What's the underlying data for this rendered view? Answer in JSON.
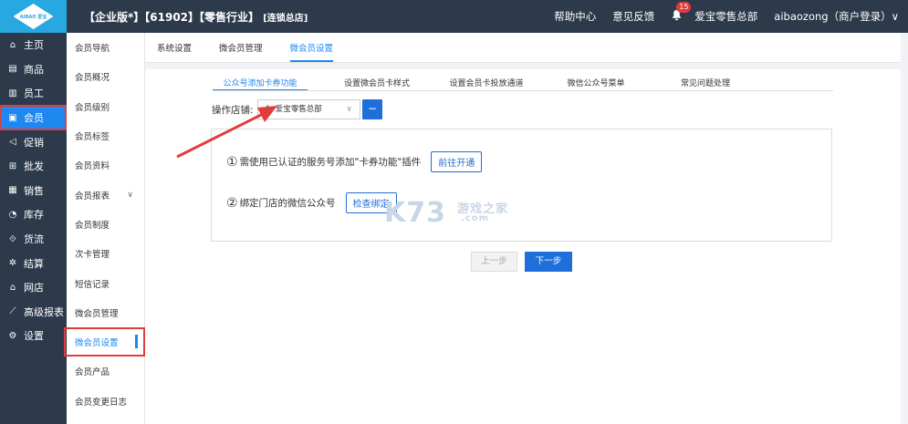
{
  "topbar": {
    "logo_text": "AIBAO 爱宝",
    "title_main": "【企业版*】【61902】【零售行业】",
    "title_small": "[连锁总店]",
    "help": "帮助中心",
    "feedback": "意见反馈",
    "notif_count": "15",
    "company": "爱宝零售总部",
    "user": "aibaozong（商户登录）∨"
  },
  "mainnav": {
    "items": [
      {
        "label": "主页",
        "icon": "home-icon",
        "glyph": "⌂"
      },
      {
        "label": "商品",
        "icon": "goods-icon",
        "glyph": "▤"
      },
      {
        "label": "员工",
        "icon": "staff-icon",
        "glyph": "▥"
      },
      {
        "label": "会员",
        "icon": "member-icon",
        "glyph": "▣"
      },
      {
        "label": "促销",
        "icon": "promo-icon",
        "glyph": "◁"
      },
      {
        "label": "批发",
        "icon": "wholesale-icon",
        "glyph": "⊞"
      },
      {
        "label": "销售",
        "icon": "sales-icon",
        "glyph": "▦"
      },
      {
        "label": "库存",
        "icon": "stock-icon",
        "glyph": "◔"
      },
      {
        "label": "货流",
        "icon": "flow-icon",
        "glyph": "⟐"
      },
      {
        "label": "结算",
        "icon": "settle-icon",
        "glyph": "✲"
      },
      {
        "label": "网店",
        "icon": "shop-icon",
        "glyph": "⌂"
      },
      {
        "label": "高级报表",
        "icon": "report-icon",
        "glyph": "⟋"
      },
      {
        "label": "设置",
        "icon": "settings-icon",
        "glyph": "⚙"
      }
    ]
  },
  "subnav": {
    "items": [
      "会员导航",
      "会员概况",
      "会员级别",
      "会员标签",
      "会员资料",
      "会员报表",
      "会员制度",
      "次卡管理",
      "短信记录",
      "微会员管理",
      "微会员设置",
      "会员产品",
      "会员变更日志"
    ]
  },
  "tabs": [
    "系统设置",
    "微会员管理",
    "微会员设置"
  ],
  "subtabs": [
    "公众号添加卡券功能",
    "设置微会员卡样式",
    "设置会员卡投放通道",
    "微信公众号菜单",
    "常见问题处理"
  ],
  "store": {
    "label": "操作店铺:",
    "selected": "1. 爱宝零售总部",
    "btn": "−"
  },
  "steps": [
    {
      "num": "①",
      "text": "需使用已认证的服务号添加\"卡券功能\"插件",
      "btn": "前往开通"
    },
    {
      "num": "②",
      "text": "绑定门店的微信公众号",
      "btn": "检查绑定"
    }
  ],
  "actions": {
    "prev": "上一步",
    "next": "下一步"
  },
  "watermark": {
    "main": "K73",
    "sub": "游戏之家",
    "domain": ".com"
  },
  "colors": {
    "sidebar": "#2d3a4b",
    "accent": "#1e87f0",
    "highlight": "#e23b3b"
  }
}
